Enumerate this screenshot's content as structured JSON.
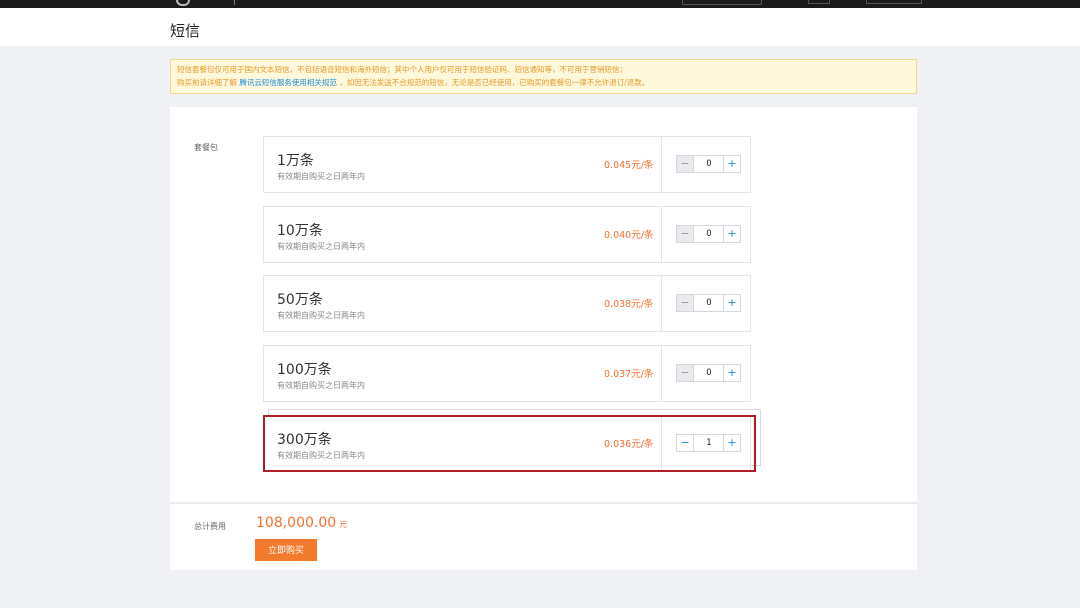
{
  "page": {
    "title": "短信"
  },
  "notice": {
    "line1": "短信套餐包仅可用于国内文本短信，不包括语音短信和海外短信；其中个人用户仅可用于短信验证码、短信通知等，不可用于营销短信；",
    "line2_prefix": "购买前请详细了解",
    "line2_link": "腾讯云短信服务使用相关规范",
    "line2_suffix": "，如因无法发送不合规范的短信，无论是否已经使用，已购买的套餐包一律不允许退订/退款。"
  },
  "packages": {
    "label": "套餐包",
    "items": [
      {
        "name": "1万条",
        "desc": "有效期自购买之日两年内",
        "price": "0.045元/条",
        "qty": "0",
        "minus": "−",
        "plus": "+"
      },
      {
        "name": "10万条",
        "desc": "有效期自购买之日两年内",
        "price": "0.040元/条",
        "qty": "0",
        "minus": "−",
        "plus": "+"
      },
      {
        "name": "50万条",
        "desc": "有效期自购买之日两年内",
        "price": "0.038元/条",
        "qty": "0",
        "minus": "−",
        "plus": "+"
      },
      {
        "name": "100万条",
        "desc": "有效期自购买之日两年内",
        "price": "0.037元/条",
        "qty": "0",
        "minus": "−",
        "plus": "+"
      },
      {
        "name": "300万条",
        "desc": "有效期自购买之日两年内",
        "price": "0.036元/条",
        "qty": "1",
        "minus": "−",
        "plus": "+"
      }
    ]
  },
  "total": {
    "label": "总计费用",
    "amount": "108,000.00",
    "unit": "元"
  },
  "buy_button": {
    "label": "立即购买"
  },
  "colors": {
    "accent_orange": "#f0702d",
    "link_blue": "#1e8cd8",
    "highlight_red": "#b01e28",
    "topbar": "#1b1b1b"
  }
}
